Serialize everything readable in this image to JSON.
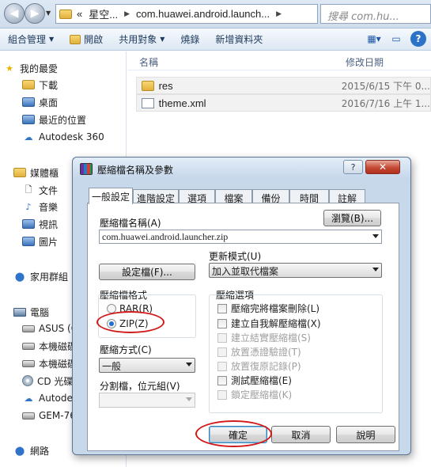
{
  "explorer": {
    "address_segments": [
      "«",
      "星空...",
      "com.huawei.android.launch..."
    ],
    "search_placeholder": "搜尋 com.hu...",
    "toolbar": {
      "organize": "組合管理",
      "open": "開啟",
      "share": "共用對象",
      "burn": "燒錄",
      "new_folder": "新增資料夾"
    },
    "sidebar": {
      "favorites": "我的最愛",
      "downloads": "下載",
      "desktop": "桌面",
      "recent": "最近的位置",
      "autodesk": "Autodesk 360",
      "libraries": "媒體櫃",
      "documents": "文件",
      "music": "音樂",
      "videos": "視訊",
      "pictures": "圖片",
      "homegroup": "家用群組",
      "computer": "電腦",
      "asus": "ASUS (C",
      "local1": "本機磁碟",
      "local2": "本機磁碟",
      "cd": "CD 光碟",
      "autodesk2": "Autode",
      "gem": "GEM-76",
      "network": "網路"
    },
    "columns": {
      "name": "名稱",
      "modified": "修改日期"
    },
    "files": [
      {
        "name": "res",
        "date": "2015/6/15 下午 0..."
      },
      {
        "name": "theme.xml",
        "date": "2016/7/16 上午 1..."
      }
    ]
  },
  "dialog": {
    "title": "壓縮檔名稱及參數",
    "title_help": "?",
    "title_close": "✕",
    "tabs": [
      "一般設定",
      "進階設定",
      "選項",
      "檔案",
      "備份",
      "時間",
      "註解"
    ],
    "archive_name_label": "壓縮檔名稱(A)",
    "browse": "瀏覽(B)...",
    "archive_name": "com.huawei.android.launcher.zip",
    "profiles": "設定檔(F)...",
    "update_mode_label": "更新模式(U)",
    "update_mode": "加入並取代檔案",
    "format_label": "壓縮檔格式",
    "format_rar": "RAR(R)",
    "format_zip": "ZIP(Z)",
    "method_label": "壓縮方式(C)",
    "method": "一般",
    "split_label": "分割檔，位元組(V)",
    "options_label": "壓縮選項",
    "options": [
      {
        "label": "壓縮完將檔案刪除(L)",
        "enabled": true
      },
      {
        "label": "建立自我解壓縮檔(X)",
        "enabled": true
      },
      {
        "label": "建立結實壓縮檔(S)",
        "enabled": false
      },
      {
        "label": "放置憑證驗證(T)",
        "enabled": false
      },
      {
        "label": "放置復原記錄(P)",
        "enabled": false
      },
      {
        "label": "測試壓縮檔(E)",
        "enabled": true
      },
      {
        "label": "鎖定壓縮檔(K)",
        "enabled": false
      }
    ],
    "ok": "確定",
    "cancel": "取消",
    "help": "說明"
  }
}
